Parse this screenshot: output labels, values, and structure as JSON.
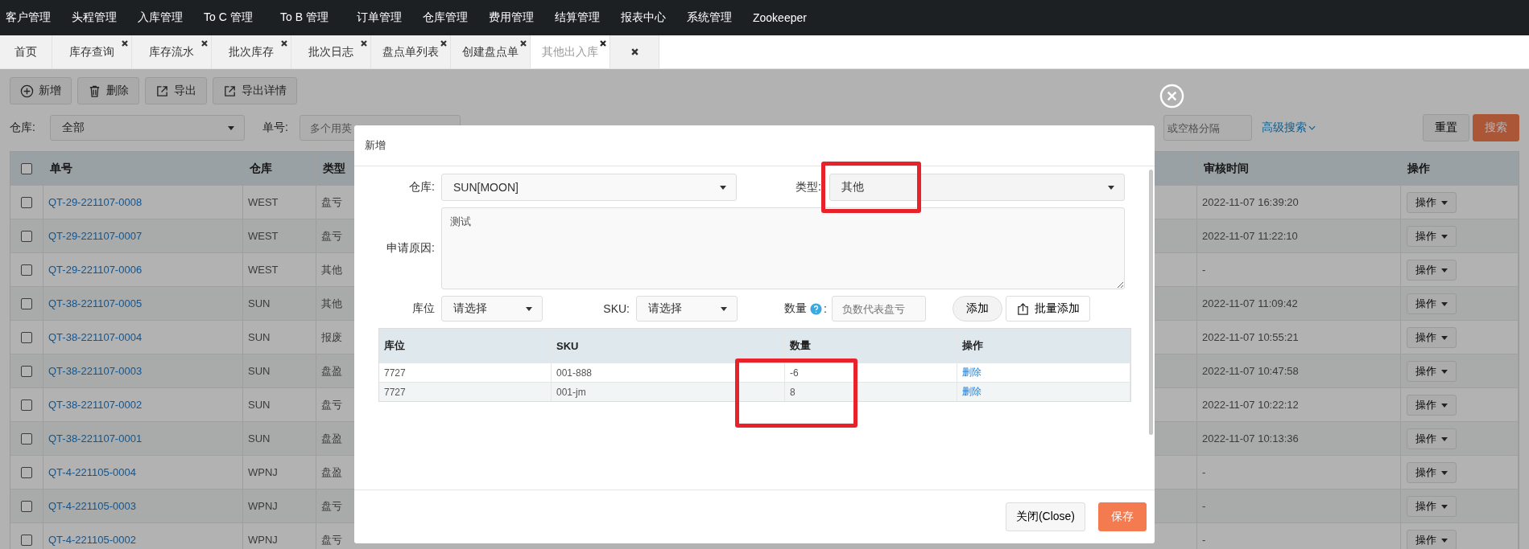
{
  "nav": {
    "items": [
      "客户管理",
      "头程管理",
      "入库管理",
      "To C 管理",
      "To B 管理",
      "订单管理",
      "仓库管理",
      "费用管理",
      "结算管理",
      "报表中心",
      "系统管理",
      "Zookeeper"
    ]
  },
  "tabs": [
    {
      "label": "首页",
      "closable": false,
      "selected": false
    },
    {
      "label": "库存查询",
      "closable": true,
      "selected": false
    },
    {
      "label": "库存流水",
      "closable": true,
      "selected": false
    },
    {
      "label": "批次库存",
      "closable": true,
      "selected": false
    },
    {
      "label": "批次日志",
      "closable": true,
      "selected": false
    },
    {
      "label": "盘点单列表",
      "closable": true,
      "selected": false
    },
    {
      "label": "创建盘点单",
      "closable": true,
      "selected": false
    },
    {
      "label": "其他出入库",
      "closable": true,
      "selected": true
    },
    {
      "closable": true,
      "selected": false
    }
  ],
  "toolbar": [
    {
      "label": "新增",
      "kind": "add"
    },
    {
      "label": "删除",
      "kind": "delete"
    },
    {
      "label": "导出",
      "kind": "export"
    },
    {
      "label": "导出详情",
      "kind": "export"
    }
  ],
  "search": {
    "warehouse_label": "仓库:",
    "warehouse_value": "全部",
    "order_label": "单号:",
    "order_placeholder": "多个用英",
    "product_placeholder": "或空格分隔",
    "advanced": "高级搜索",
    "reset": "重置",
    "search": "搜索"
  },
  "table": {
    "all_checked": false,
    "columns": [
      "单号",
      "仓库",
      "类型",
      "审核时间",
      "操作"
    ],
    "rows": [
      {
        "no": "QT-29-221107-0008",
        "warehouse": "WEST",
        "type": "盘亏",
        "audit_time": "2022-11-07 16:39:20",
        "action": "操作",
        "checked": false
      },
      {
        "no": "QT-29-221107-0007",
        "warehouse": "WEST",
        "type": "盘亏",
        "audit_time": "2022-11-07 11:22:10",
        "action": "操作",
        "checked": false
      },
      {
        "no": "QT-29-221107-0006",
        "warehouse": "WEST",
        "type": "其他",
        "audit_time": "-",
        "action": "操作",
        "checked": false
      },
      {
        "no": "QT-38-221107-0005",
        "warehouse": "SUN",
        "type": "其他",
        "audit_time": "2022-11-07 11:09:42",
        "action": "操作",
        "checked": false
      },
      {
        "no": "QT-38-221107-0004",
        "warehouse": "SUN",
        "type": "报废",
        "audit_time": "2022-11-07 10:55:21",
        "action": "操作",
        "checked": false
      },
      {
        "no": "QT-38-221107-0003",
        "warehouse": "SUN",
        "type": "盘盈",
        "audit_time": "2022-11-07 10:47:58",
        "action": "操作",
        "checked": false
      },
      {
        "no": "QT-38-221107-0002",
        "warehouse": "SUN",
        "type": "盘亏",
        "audit_time": "2022-11-07 10:22:12",
        "action": "操作",
        "checked": false
      },
      {
        "no": "QT-38-221107-0001",
        "warehouse": "SUN",
        "type": "盘盈",
        "audit_time": "2022-11-07 10:13:36",
        "action": "操作",
        "checked": false
      },
      {
        "no": "QT-4-221105-0004",
        "warehouse": "WPNJ",
        "type": "盘盈",
        "audit_time": "-",
        "action": "操作",
        "checked": false
      },
      {
        "no": "QT-4-221105-0003",
        "warehouse": "WPNJ",
        "type": "盘亏",
        "audit_time": "-",
        "action": "操作",
        "checked": false
      },
      {
        "no": "QT-4-221105-0002",
        "warehouse": "WPNJ",
        "type": "盘亏",
        "audit_time": "-",
        "action": "操作",
        "checked": false
      }
    ]
  },
  "modal": {
    "title": "新增",
    "warehouse": {
      "label": "仓库:",
      "value": "SUN[MOON]"
    },
    "type": {
      "label": "类型:",
      "value": "其他",
      "highlighted": true
    },
    "reason": {
      "label": "申请原因:",
      "value": "测试"
    },
    "location": {
      "label": "库位",
      "value": "请选择"
    },
    "sku": {
      "label": "SKU:",
      "value": "请选择"
    },
    "quantity": {
      "label": "数量",
      "colon": ":",
      "placeholder": "负数代表盘亏"
    },
    "add": "添加",
    "batch_add": "批量添加",
    "items_table": {
      "columns": [
        {
          "label": "库位",
          "highlighted": false
        },
        {
          "label": "SKU",
          "highlighted": false
        },
        {
          "label": "数量",
          "highlighted": true
        },
        {
          "label": "操作",
          "highlighted": false
        }
      ],
      "rows": [
        {
          "location": "7727",
          "sku": "001-888",
          "quantity": "-6",
          "action": "删除"
        },
        {
          "location": "7727",
          "sku": "001-jm",
          "quantity": "8",
          "action": "删除"
        }
      ]
    },
    "close": "关闭(Close)",
    "save": "保存"
  }
}
